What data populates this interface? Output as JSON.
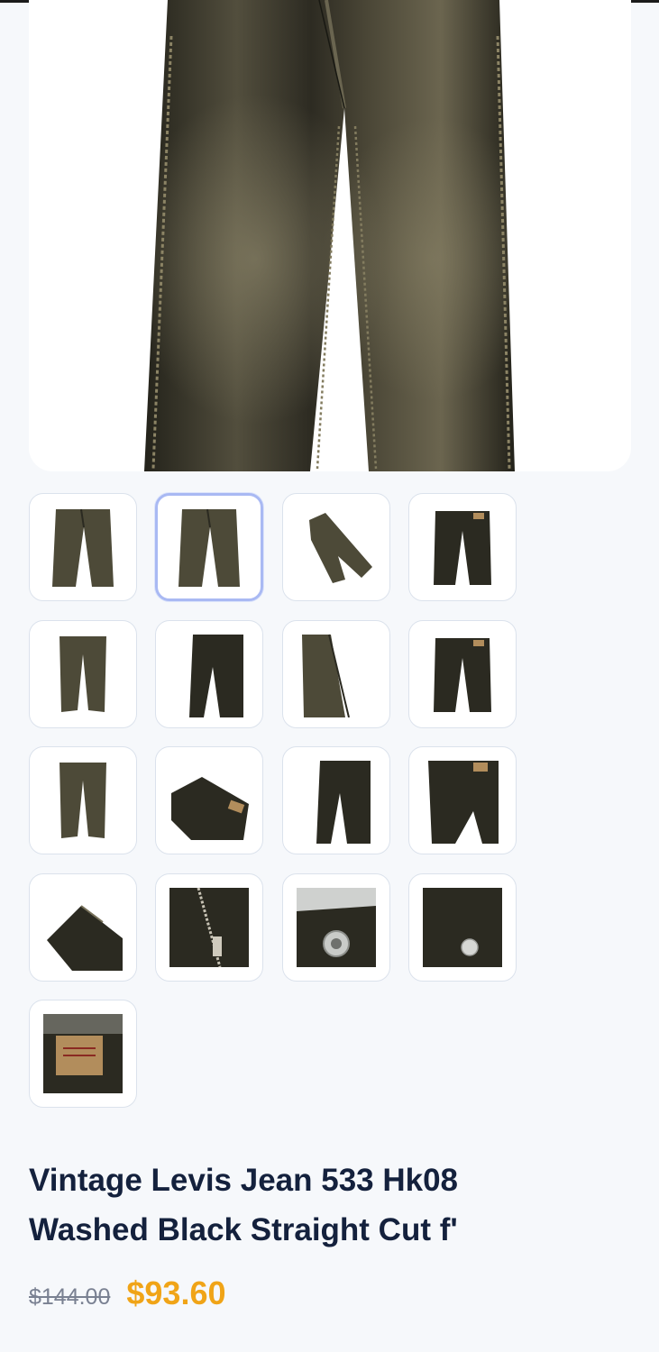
{
  "product": {
    "title_line1": "Vintage Levis Jean 533 Hk08",
    "title_line2": "Washed Black Straight Cut f'",
    "original_price": "$144.00",
    "sale_price": "$93.60"
  },
  "gallery": {
    "main_image": "washed-black-jeans-photo",
    "selected_thumbnail": 2,
    "thumbnails": [
      {
        "name": "front-full-view-thumbnail",
        "kind": "front"
      },
      {
        "name": "front-alt-view-thumbnail",
        "kind": "front"
      },
      {
        "name": "diagonal-flat-lay-thumbnail",
        "kind": "diagonal"
      },
      {
        "name": "back-view-thumbnail",
        "kind": "back"
      },
      {
        "name": "folded-legs-thumbnail",
        "kind": "legs"
      },
      {
        "name": "right-leg-front-thumbnail",
        "kind": "half-right"
      },
      {
        "name": "left-leg-front-thumbnail",
        "kind": "half-left"
      },
      {
        "name": "back-waist-thumbnail",
        "kind": "back"
      },
      {
        "name": "lower-legs-thumbnail",
        "kind": "legs"
      },
      {
        "name": "leather-patch-angle-thumbnail",
        "kind": "angled-back"
      },
      {
        "name": "side-leg-thumbnail",
        "kind": "half-right"
      },
      {
        "name": "back-pocket-thumbnail",
        "kind": "pocket"
      },
      {
        "name": "folded-denim-thumbnail",
        "kind": "folded"
      },
      {
        "name": "zipper-closeup-thumbnail",
        "kind": "zipper"
      },
      {
        "name": "button-closeup-thumbnail",
        "kind": "button"
      },
      {
        "name": "rivet-closeup-thumbnail",
        "kind": "rivet"
      },
      {
        "name": "patch-label-closeup-thumbnail",
        "kind": "label"
      }
    ]
  },
  "colors": {
    "denim_dark": "#2b2a21",
    "denim_mid": "#4d4a38",
    "denim_light": "#77715a",
    "patch": "#b28d5c",
    "selected_border": "#a9b9f3",
    "price_accent": "#f0a417",
    "title_text": "#14213d"
  }
}
